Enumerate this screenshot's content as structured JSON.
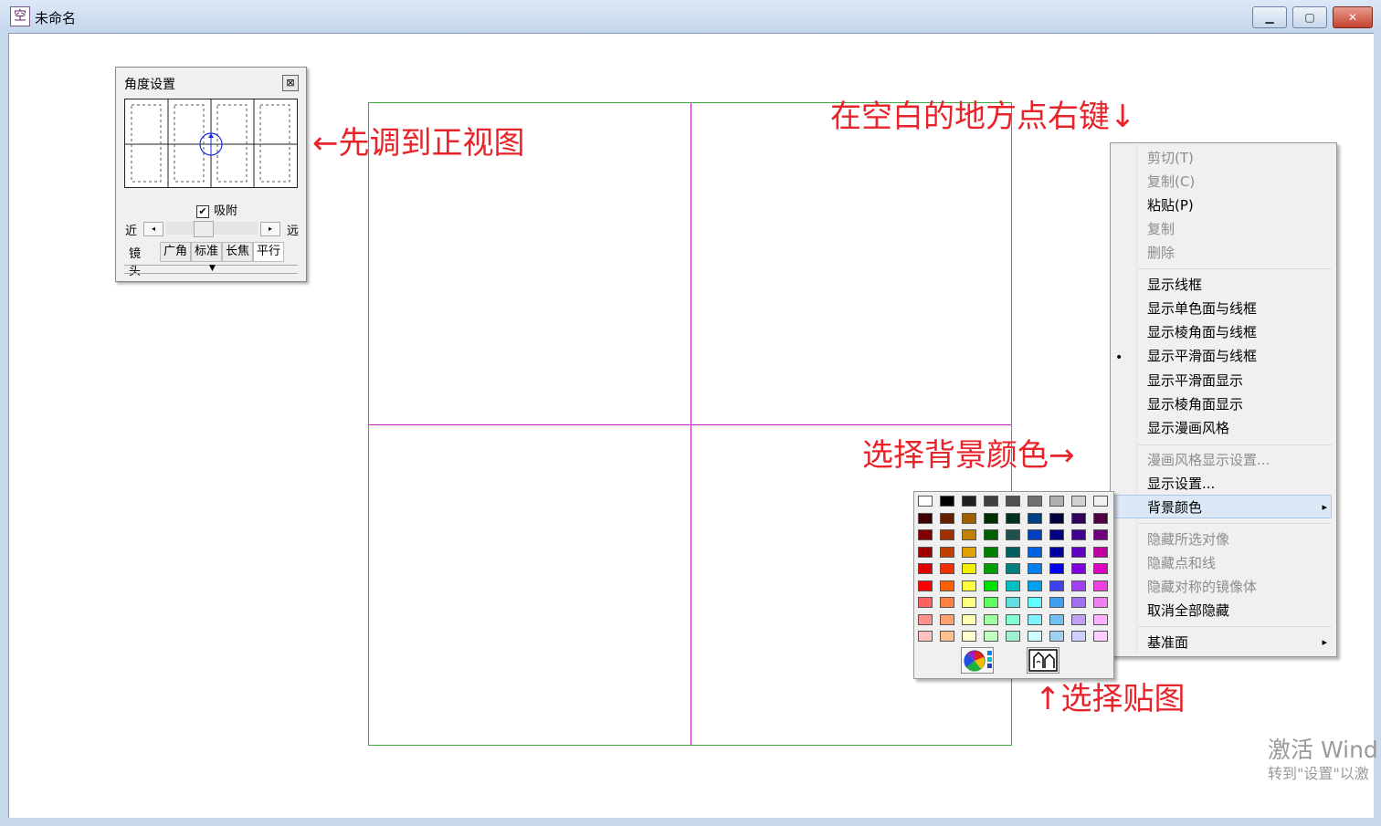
{
  "window": {
    "title": "未命名",
    "minimize_label": "▁",
    "maximize_label": "▢",
    "close_label": "✕",
    "app_icon_name": "app-house-icon",
    "app_icon_glyph": "空"
  },
  "angle_panel": {
    "title": "角度设置",
    "close_glyph": "⊠",
    "snap_checked": true,
    "snap_check_glyph": "✔",
    "snap_label": "吸附",
    "near_label": "近",
    "far_label": "远",
    "left_arrow": "◂",
    "right_arrow": "▸",
    "lens_label": "镜头",
    "tabs": [
      "广角",
      "标准",
      "长焦",
      "平行"
    ],
    "expand_glyph": "▼"
  },
  "annotations": {
    "front_view": "←先调到正视图",
    "right_click": "在空白的地方点右键↓",
    "bg_color": "选择背景颜色→",
    "texture": "↑选择贴图"
  },
  "context_menu": {
    "items": [
      {
        "label": "剪切(T)",
        "enabled": false
      },
      {
        "label": "复制(C)",
        "enabled": false
      },
      {
        "label": "粘贴(P)",
        "enabled": true
      },
      {
        "label": "复制",
        "enabled": false
      },
      {
        "label": "删除",
        "enabled": false
      },
      {
        "label": "显示线框",
        "enabled": true
      },
      {
        "label": "显示单色面与线框",
        "enabled": true
      },
      {
        "label": "显示棱角面与线框",
        "enabled": true
      },
      {
        "label": "显示平滑面与线框",
        "enabled": true,
        "selected": true
      },
      {
        "label": "显示平滑面显示",
        "enabled": true
      },
      {
        "label": "显示棱角面显示",
        "enabled": true
      },
      {
        "label": "显示漫画风格",
        "enabled": true
      },
      {
        "label": "漫画风格显示设置...",
        "enabled": false
      },
      {
        "label": "显示设置...",
        "enabled": true
      },
      {
        "label": "背景颜色",
        "enabled": true,
        "submenu": true,
        "highlighted": true
      },
      {
        "label": "隐藏所选对像",
        "enabled": false
      },
      {
        "label": "隐藏点和线",
        "enabled": false
      },
      {
        "label": "隐藏对称的镜像体",
        "enabled": false
      },
      {
        "label": "取消全部隐藏",
        "enabled": true
      },
      {
        "label": "基准面",
        "enabled": true,
        "submenu": true
      }
    ],
    "bullet_glyph": "•",
    "submenu_glyph": "▸"
  },
  "palette": {
    "colors": [
      [
        "#ffffff",
        "#000000",
        "#202020",
        "#404040",
        "#505050",
        "#707070",
        "#b0b0b0",
        "#d0d0d0",
        "#f0f0f0"
      ],
      [
        "#400000",
        "#602000",
        "#a06000",
        "#003000",
        "#003020",
        "#004080",
        "#000040",
        "#300060",
        "#500040"
      ],
      [
        "#800000",
        "#a03000",
        "#c08000",
        "#006000",
        "#205050",
        "#0040c0",
        "#000080",
        "#400090",
        "#700080"
      ],
      [
        "#a00000",
        "#c04000",
        "#e0a000",
        "#008000",
        "#006060",
        "#0060e0",
        "#0000a0",
        "#6000c0",
        "#c000a0"
      ],
      [
        "#e00000",
        "#f03000",
        "#f0f000",
        "#00a000",
        "#008080",
        "#0080f0",
        "#0000f0",
        "#8000e0",
        "#e000c0"
      ],
      [
        "#ff0000",
        "#ff6000",
        "#ffff40",
        "#00e000",
        "#00c0c0",
        "#00a0f0",
        "#4040f0",
        "#a040f0",
        "#f040e0"
      ],
      [
        "#ff6060",
        "#ff8040",
        "#ffff80",
        "#60ff60",
        "#60e0e0",
        "#60ffff",
        "#40a0f0",
        "#a070f0",
        "#f080f0"
      ],
      [
        "#ff9090",
        "#ffa070",
        "#ffffb0",
        "#a0ffa0",
        "#80ffd0",
        "#80f0ff",
        "#70c0f0",
        "#c0a0f0",
        "#ffb0ff"
      ],
      [
        "#ffc0c0",
        "#ffc090",
        "#ffffd0",
        "#c0ffc0",
        "#a0f0d0",
        "#d0ffff",
        "#a0d0f0",
        "#d0d0ff",
        "#ffd0ff"
      ]
    ],
    "color_wheel_icon": "color-wheel-icon",
    "texture_icon": "texture-image-icon"
  },
  "watermark": {
    "line1": "激活 Wind",
    "line2": "转到\"设置\"以激"
  }
}
